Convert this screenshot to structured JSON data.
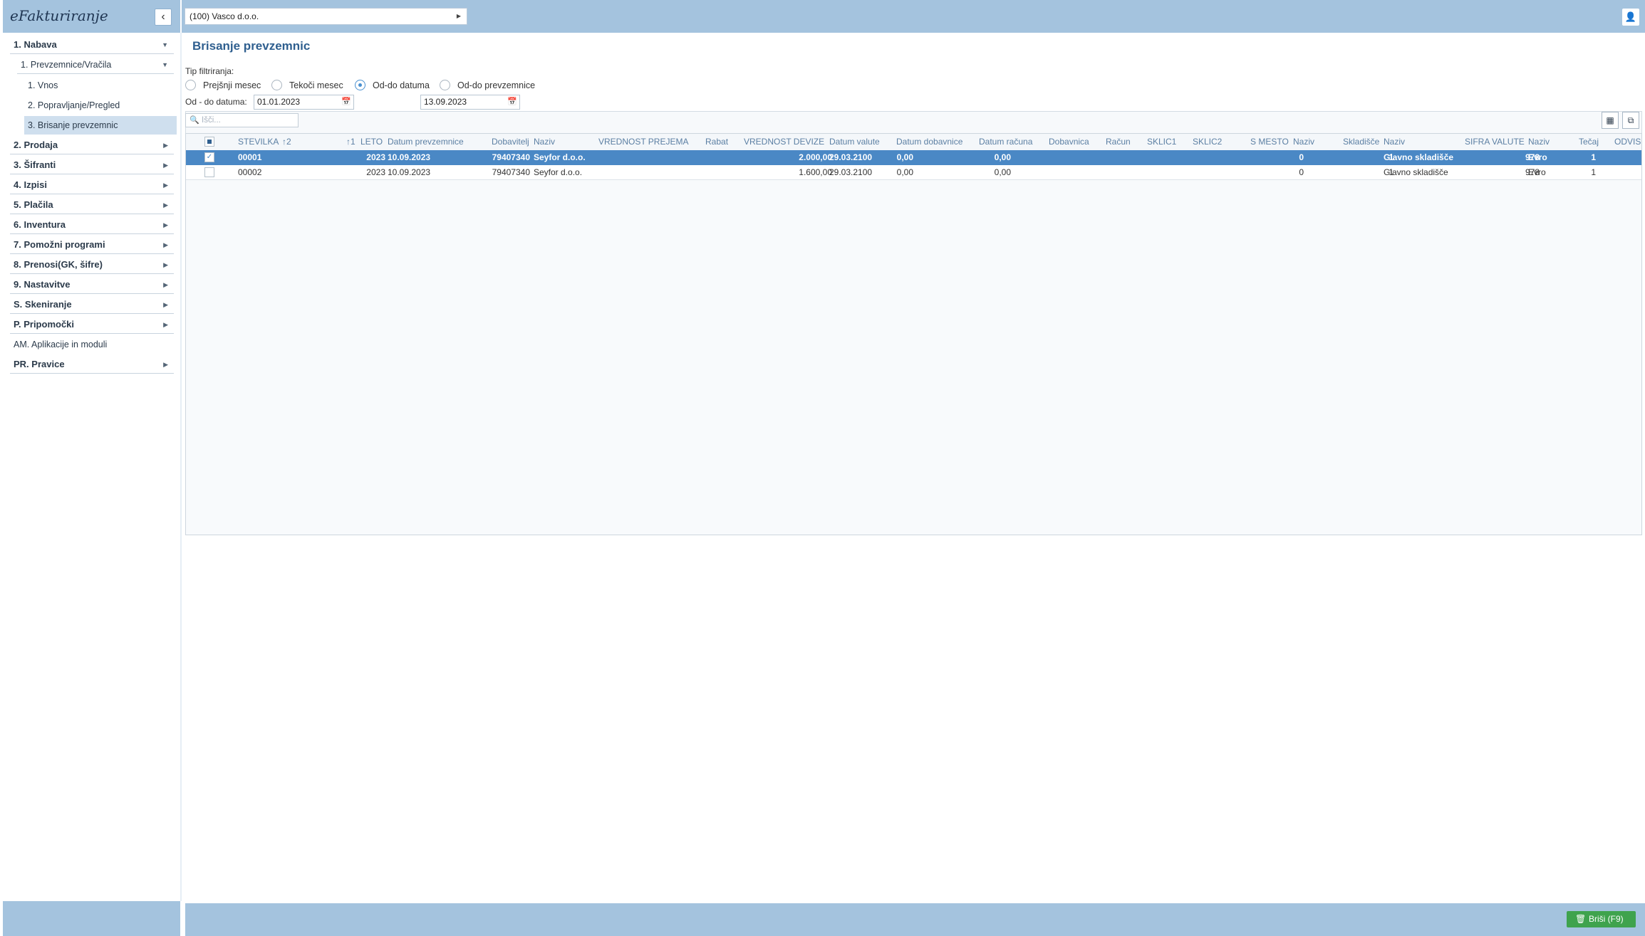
{
  "app": {
    "title": "eFakturiranje",
    "collapse_icon": "‹"
  },
  "topbar": {
    "company": "(100) Vasco d.o.o.",
    "user_icon": "👤"
  },
  "sidebar": {
    "items": [
      {
        "label": "1. Nabava"
      },
      {
        "label": "1. Prevzemnice/Vračila"
      },
      {
        "label": "1. Vnos"
      },
      {
        "label": "2. Popravljanje/Pregled"
      },
      {
        "label": "3. Brisanje prevzemnic"
      },
      {
        "label": "2. Prodaja"
      },
      {
        "label": "3. Šifranti"
      },
      {
        "label": "4. Izpisi"
      },
      {
        "label": "5. Plačila"
      },
      {
        "label": "6. Inventura"
      },
      {
        "label": "7. Pomožni programi"
      },
      {
        "label": "8. Prenosi(GK, šifre)"
      },
      {
        "label": "9. Nastavitve"
      },
      {
        "label": "S. Skeniranje"
      },
      {
        "label": "P. Pripomočki"
      },
      {
        "label": "AM. Aplikacije in moduli"
      },
      {
        "label": "PR. Pravice"
      }
    ]
  },
  "page": {
    "title": "Brisanje prevzemnic",
    "filter_label": "Tip filtriranja:",
    "radios": [
      {
        "label": "Prejšnji mesec",
        "checked": false
      },
      {
        "label": "Tekoči mesec",
        "checked": false
      },
      {
        "label": "Od-do datuma",
        "checked": true
      },
      {
        "label": "Od-do prevzemnice",
        "checked": false
      }
    ],
    "date_label": "Od - do datuma:",
    "date_from": "01.01.2023",
    "date_to": "13.09.2023",
    "search_placeholder": "Išči..."
  },
  "grid": {
    "columns": {
      "stevilka": "STEVILKA",
      "stevilka_sort": "↑2",
      "leto_sort": "↑1",
      "leto": "LETO",
      "datum_prevzemnice": "Datum prevzemnice",
      "dobavitelj": "Dobavitelj",
      "naziv": "Naziv",
      "vrednost_prejema": "VREDNOST PREJEMA",
      "rabat": "Rabat",
      "vrednost_devize": "VREDNOST DEVIZE",
      "datum_valute": "Datum valute",
      "datum_dobavnice": "Datum dobavnice",
      "datum_racuna": "Datum računa",
      "dobavnica": "Dobavnica",
      "racun": "Račun",
      "sklic1": "SKLIC1",
      "sklic2": "SKLIC2",
      "s_mesto": "S MESTO",
      "naziv2": "Naziv",
      "skladisce": "Skladišče",
      "naziv3": "Naziv",
      "sifra_valute": "SIFRA VALUTE",
      "naziv4": "Naziv",
      "tecaj": "Tečaj",
      "odvis": "ODVIS"
    },
    "rows": [
      {
        "checked": true,
        "stevilka": "00001",
        "leto": "2023",
        "datum_prevzemnice": "10.09.2023",
        "dobavitelj": "79407340",
        "naziv": "Seyfor d.o.o.",
        "vrednost_prejema": "2.000,00",
        "rabat": "0,00",
        "vrednost_devize": "0,00",
        "datum_valute": "29.03.2100",
        "s_mesto": "0",
        "skladisce": "1",
        "naziv3": "Glavno skladišče",
        "sifra_valute": "978",
        "naziv4": "Evro",
        "tecaj": "1"
      },
      {
        "checked": false,
        "stevilka": "00002",
        "leto": "2023",
        "datum_prevzemnice": "10.09.2023",
        "dobavitelj": "79407340",
        "naziv": "Seyfor d.o.o.",
        "vrednost_prejema": "1.600,00",
        "rabat": "0,00",
        "vrednost_devize": "0,00",
        "datum_valute": "29.03.2100",
        "s_mesto": "0",
        "skladisce": "1",
        "naziv3": "Glavno skladišče",
        "sifra_valute": "978",
        "naziv4": "Evro",
        "tecaj": "1"
      }
    ]
  },
  "footer": {
    "delete_label": "Briši (F9)"
  },
  "colors": {
    "accent_bar": "#a4c3de",
    "selected_row": "#4a88c5",
    "delete_button": "#3fa34d"
  }
}
